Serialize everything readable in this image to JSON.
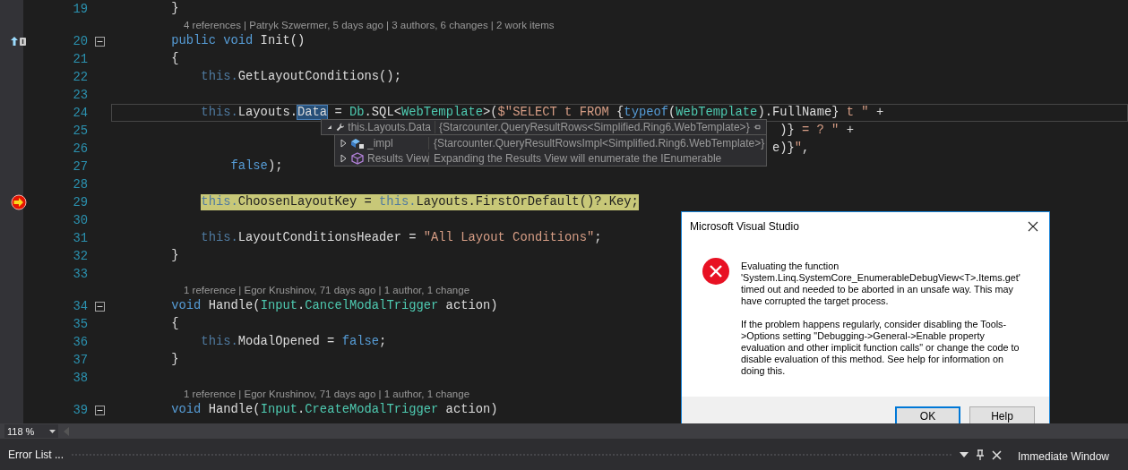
{
  "editor": {
    "lines": [
      {
        "kind": "code",
        "number": "19",
        "tokens": [
          {
            "kind": "plain",
            "text": "        }"
          }
        ]
      },
      {
        "kind": "lens",
        "text": "4 references | Patryk Szwermer, 5 days ago | 3 authors, 6 changes | 2 work items"
      },
      {
        "kind": "code",
        "number": "20",
        "codelens_marker": true,
        "collapsible": true,
        "tokens": [
          {
            "kind": "keyword",
            "text": "        public"
          },
          {
            "kind": "keyword",
            "text": " void"
          },
          {
            "kind": "plain",
            "text": " Init()"
          }
        ]
      },
      {
        "kind": "code",
        "number": "21",
        "tokens": [
          {
            "kind": "plain",
            "text": "        {"
          }
        ]
      },
      {
        "kind": "code",
        "number": "22",
        "tokens": [
          {
            "kind": "faded",
            "text": "            this."
          },
          {
            "kind": "plain",
            "text": "GetLayoutConditions();"
          }
        ]
      },
      {
        "kind": "code",
        "number": "23"
      },
      {
        "kind": "code",
        "number": "24",
        "current": true,
        "tokens": [
          {
            "kind": "faded",
            "text": "            this."
          },
          {
            "kind": "plain",
            "text": "Layouts."
          },
          {
            "kind": "selected",
            "text": "Data"
          },
          {
            "kind": "plain",
            "text": " = "
          },
          {
            "kind": "type",
            "text": "Db"
          },
          {
            "kind": "plain",
            "text": ".SQL<"
          },
          {
            "kind": "type",
            "text": "WebTemplate"
          },
          {
            "kind": "plain",
            "text": ">("
          },
          {
            "kind": "string",
            "text": "$\"SELECT t FROM "
          },
          {
            "kind": "plain",
            "text": "{"
          },
          {
            "kind": "keyword",
            "text": "typeof"
          },
          {
            "kind": "plain",
            "text": "("
          },
          {
            "kind": "type",
            "text": "WebTemplate"
          },
          {
            "kind": "plain",
            "text": ").FullName}"
          },
          {
            "kind": "string",
            "text": " t \" "
          },
          {
            "kind": "plain",
            "text": "+"
          }
        ]
      },
      {
        "kind": "code",
        "number": "25",
        "tokens": [
          {
            "kind": "plain",
            "text": "                                                                                          )}"
          },
          {
            "kind": "string",
            "text": " = ? \" "
          },
          {
            "kind": "plain",
            "text": "+"
          }
        ]
      },
      {
        "kind": "code",
        "number": "26",
        "tokens": [
          {
            "kind": "plain",
            "text": "                                                                                         e)}"
          },
          {
            "kind": "string",
            "text": "\""
          },
          {
            "kind": "plain",
            "text": ","
          }
        ]
      },
      {
        "kind": "code",
        "number": "27",
        "tokens": [
          {
            "kind": "keyword",
            "text": "                false"
          },
          {
            "kind": "plain",
            "text": ");"
          }
        ]
      },
      {
        "kind": "code",
        "number": "28"
      },
      {
        "kind": "code",
        "number": "29",
        "current_statement": true,
        "highlighted": true,
        "tokens": [
          {
            "kind": "faded",
            "text": "            this."
          },
          {
            "kind": "plain",
            "text": "ChoosenLayoutKey = "
          },
          {
            "kind": "faded",
            "text": "this."
          },
          {
            "kind": "plain",
            "text": "Layouts.FirstOrDefault()?.Key;"
          }
        ]
      },
      {
        "kind": "code",
        "number": "30"
      },
      {
        "kind": "code",
        "number": "31",
        "tokens": [
          {
            "kind": "faded",
            "text": "            this."
          },
          {
            "kind": "plain",
            "text": "LayoutConditionsHeader = "
          },
          {
            "kind": "string",
            "text": "\"All Layout Conditions\""
          },
          {
            "kind": "plain",
            "text": ";"
          }
        ]
      },
      {
        "kind": "code",
        "number": "32",
        "tokens": [
          {
            "kind": "plain",
            "text": "        }"
          }
        ]
      },
      {
        "kind": "code",
        "number": "33"
      },
      {
        "kind": "lens",
        "text": "1 reference | Egor Krushinov, 71 days ago | 1 author, 1 change"
      },
      {
        "kind": "code",
        "number": "34",
        "collapsible": true,
        "tokens": [
          {
            "kind": "keyword",
            "text": "        void"
          },
          {
            "kind": "plain",
            "text": " Handle("
          },
          {
            "kind": "type",
            "text": "Input"
          },
          {
            "kind": "plain",
            "text": "."
          },
          {
            "kind": "type",
            "text": "CancelModalTrigger"
          },
          {
            "kind": "plain",
            "text": " action)"
          }
        ]
      },
      {
        "kind": "code",
        "number": "35",
        "tokens": [
          {
            "kind": "plain",
            "text": "        {"
          }
        ]
      },
      {
        "kind": "code",
        "number": "36",
        "tokens": [
          {
            "kind": "faded",
            "text": "            this."
          },
          {
            "kind": "plain",
            "text": "ModalOpened = "
          },
          {
            "kind": "keyword",
            "text": "false"
          },
          {
            "kind": "plain",
            "text": ";"
          }
        ]
      },
      {
        "kind": "code",
        "number": "37",
        "tokens": [
          {
            "kind": "plain",
            "text": "        }"
          }
        ]
      },
      {
        "kind": "code",
        "number": "38"
      },
      {
        "kind": "lens",
        "text": "1 reference | Egor Krushinov, 71 days ago | 1 author, 1 change"
      },
      {
        "kind": "code",
        "number": "39",
        "collapsible": true,
        "tokens": [
          {
            "kind": "keyword",
            "text": "        void"
          },
          {
            "kind": "plain",
            "text": " Handle("
          },
          {
            "kind": "type",
            "text": "Input"
          },
          {
            "kind": "plain",
            "text": "."
          },
          {
            "kind": "type",
            "text": "CreateModalTrigger"
          },
          {
            "kind": "plain",
            "text": " action)"
          }
        ]
      }
    ]
  },
  "datatip": {
    "name": "this.Layouts.Data",
    "value": "{Starcounter.QueryResultRows<Simplified.Ring6.WebTemplate>}",
    "expanded": true,
    "children": [
      {
        "kind": "field",
        "name": "_impl",
        "value": "{Starcounter.QueryResultRowsImpl<Simplified.Ring6.WebTemplate>}",
        "expanded": false
      },
      {
        "kind": "results",
        "name": "Results View",
        "value": "Expanding the Results View will enumerate the IEnumerable",
        "expanded": false
      }
    ]
  },
  "zoom": "118 %",
  "dialog": {
    "title": "Microsoft Visual Studio",
    "paragraphs": [
      "Evaluating the function 'System.Linq.SystemCore_EnumerableDebugView<T>.Items.get' timed out and needed to be aborted in an unsafe way. This may have corrupted the target process.",
      "If the problem happens regularly, consider disabling the Tools->Options setting \"Debugging->General->Enable property evaluation and other implicit function calls\" or change the code to disable evaluation of this method. See help for information on doing this."
    ],
    "buttons": [
      {
        "label": "OK",
        "selected": true
      },
      {
        "label": "Help",
        "selected": false
      }
    ]
  },
  "panel": {
    "title": "Error List ...",
    "side_tab": "Immediate Window"
  }
}
